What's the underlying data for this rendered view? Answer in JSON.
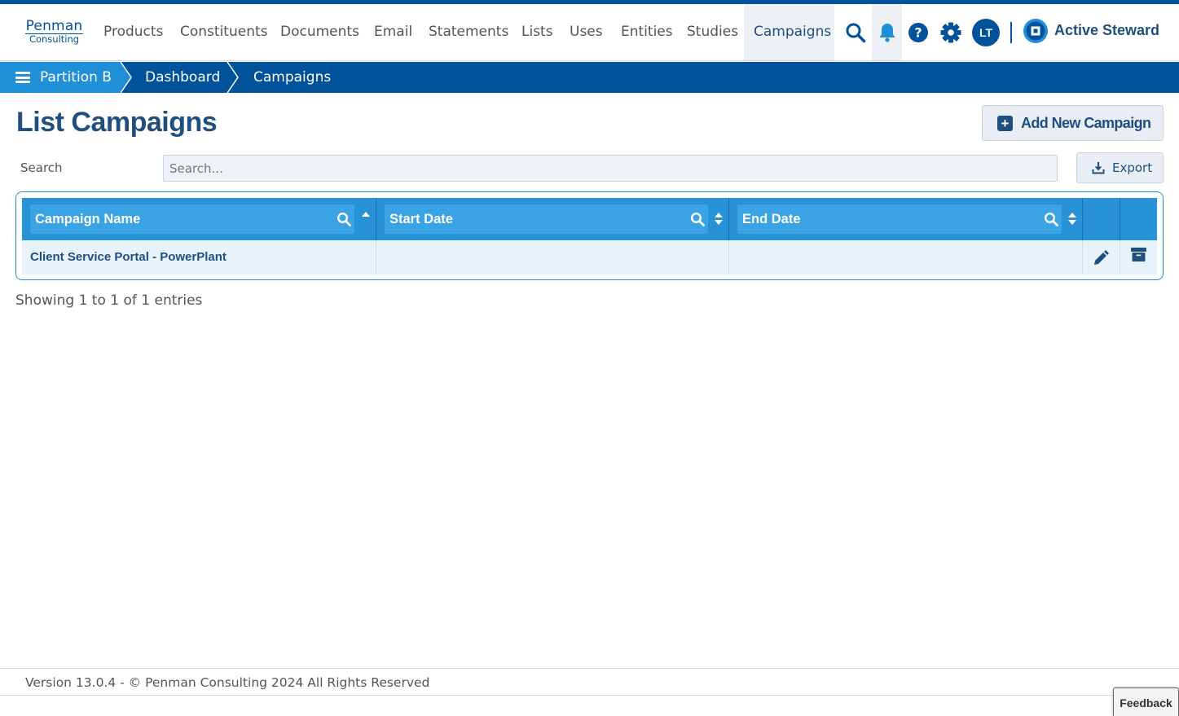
{
  "brand": {
    "logo_line1": "Penman",
    "logo_line2": "Consulting",
    "product_name": "Active Steward"
  },
  "nav": {
    "items": [
      {
        "label": "Products"
      },
      {
        "label": "Constituents"
      },
      {
        "label": "Documents"
      },
      {
        "label": "Email"
      },
      {
        "label": "Statements"
      },
      {
        "label": "Lists"
      },
      {
        "label": "Uses"
      },
      {
        "label": "Entities"
      },
      {
        "label": "Studies"
      },
      {
        "label": "Campaigns",
        "active": true
      }
    ],
    "icons": [
      "search-icon",
      "bell-icon",
      "help-icon",
      "gear-icon"
    ],
    "avatar_initials": "LT"
  },
  "breadcrumb": {
    "items": [
      "Partition B",
      "Dashboard",
      "Campaigns"
    ]
  },
  "page": {
    "title": "List Campaigns",
    "add_button_label": "Add New Campaign",
    "search_label": "Search",
    "search_placeholder": "Search...",
    "export_label": "Export",
    "entries_text": "Showing 1 to 1 of 1 entries"
  },
  "table": {
    "columns": [
      "Campaign Name",
      "Start Date",
      "End Date"
    ],
    "rows": [
      {
        "name": "Client Service Portal - PowerPlant",
        "start": "",
        "end": ""
      }
    ]
  },
  "footer": {
    "text": "Version 13.0.4 - © Penman Consulting 2024 All Rights Reserved"
  },
  "feedback_label": "Feedback",
  "colors": {
    "primary": "#00529b",
    "accent": "#1f8fd8",
    "header_blue": "#2793d6",
    "title": "#1f4f7e"
  }
}
